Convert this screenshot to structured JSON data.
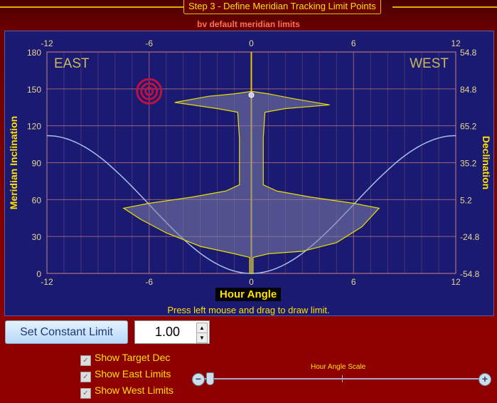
{
  "header": {
    "step_title": "Step 3 - Define Meridian Tracking Limit Points",
    "subtitle": "bv default meridian limits"
  },
  "chart_data": {
    "type": "line",
    "xlabel": "Hour Angle",
    "ylabel": "Meridian Inclination",
    "y2label": "Declination",
    "xlim": [
      -12,
      12
    ],
    "ylim": [
      0,
      180
    ],
    "x_ticks": [
      -12,
      -6,
      0,
      6,
      12
    ],
    "y_ticks": [
      0,
      30,
      60,
      90,
      120,
      150,
      180
    ],
    "y2_ticks": [
      "54.8",
      "84.8",
      "65.2",
      "35.2",
      "5.2",
      "-24.8",
      "-54.8"
    ],
    "corner_labels": {
      "east": "EAST",
      "west": "WEST"
    },
    "grid": true,
    "colors": {
      "limit": "#e8e000",
      "target_dec": "#a8c0e8",
      "target": "#c01040",
      "grid": "#d08080"
    },
    "target": {
      "ha": -6,
      "inc": 148
    },
    "meridian_marker": {
      "ha": 0,
      "inc": 145
    },
    "limit_polygon": [
      [
        0,
        148
      ],
      [
        -1,
        146
      ],
      [
        -2.5,
        144
      ],
      [
        -4.5,
        139
      ],
      [
        -2,
        134
      ],
      [
        -0.8,
        131
      ],
      [
        -0.7,
        110
      ],
      [
        -0.7,
        72
      ],
      [
        -1.5,
        67
      ],
      [
        -3.5,
        62
      ],
      [
        -6,
        57
      ],
      [
        -7.5,
        53
      ],
      [
        -6.5,
        44
      ],
      [
        -5,
        33
      ],
      [
        -3,
        22
      ],
      [
        -1,
        16
      ],
      [
        -0.1,
        13
      ],
      [
        -0.1,
        0
      ],
      [
        0.1,
        0
      ],
      [
        0.1,
        13
      ],
      [
        1,
        16
      ],
      [
        3,
        18
      ],
      [
        5,
        25
      ],
      [
        6.5,
        38
      ],
      [
        7.5,
        53
      ],
      [
        6,
        57
      ],
      [
        3.5,
        62
      ],
      [
        1.5,
        67
      ],
      [
        0.7,
        72
      ],
      [
        0.7,
        110
      ],
      [
        0.8,
        131
      ],
      [
        2,
        134
      ],
      [
        4.6,
        137
      ],
      [
        2.5,
        142
      ],
      [
        1,
        146
      ]
    ],
    "target_dec_curve": {
      "min": 0,
      "max": 112
    }
  },
  "hint": "Press left mouse and drag to draw limit.",
  "controls": {
    "set_constant_label": "Set Constant Limit",
    "constant_value": "1.00",
    "spin_up": "▲",
    "spin_down": "▼",
    "checkboxes": [
      {
        "label": "Show Target Dec",
        "checked": true
      },
      {
        "label": "Show East Limits",
        "checked": true
      },
      {
        "label": "Show West Limits",
        "checked": true
      }
    ],
    "scale_label": "Hour Angle Scale",
    "scale_minus": "−",
    "scale_plus": "+",
    "scale_value": 0.04
  }
}
